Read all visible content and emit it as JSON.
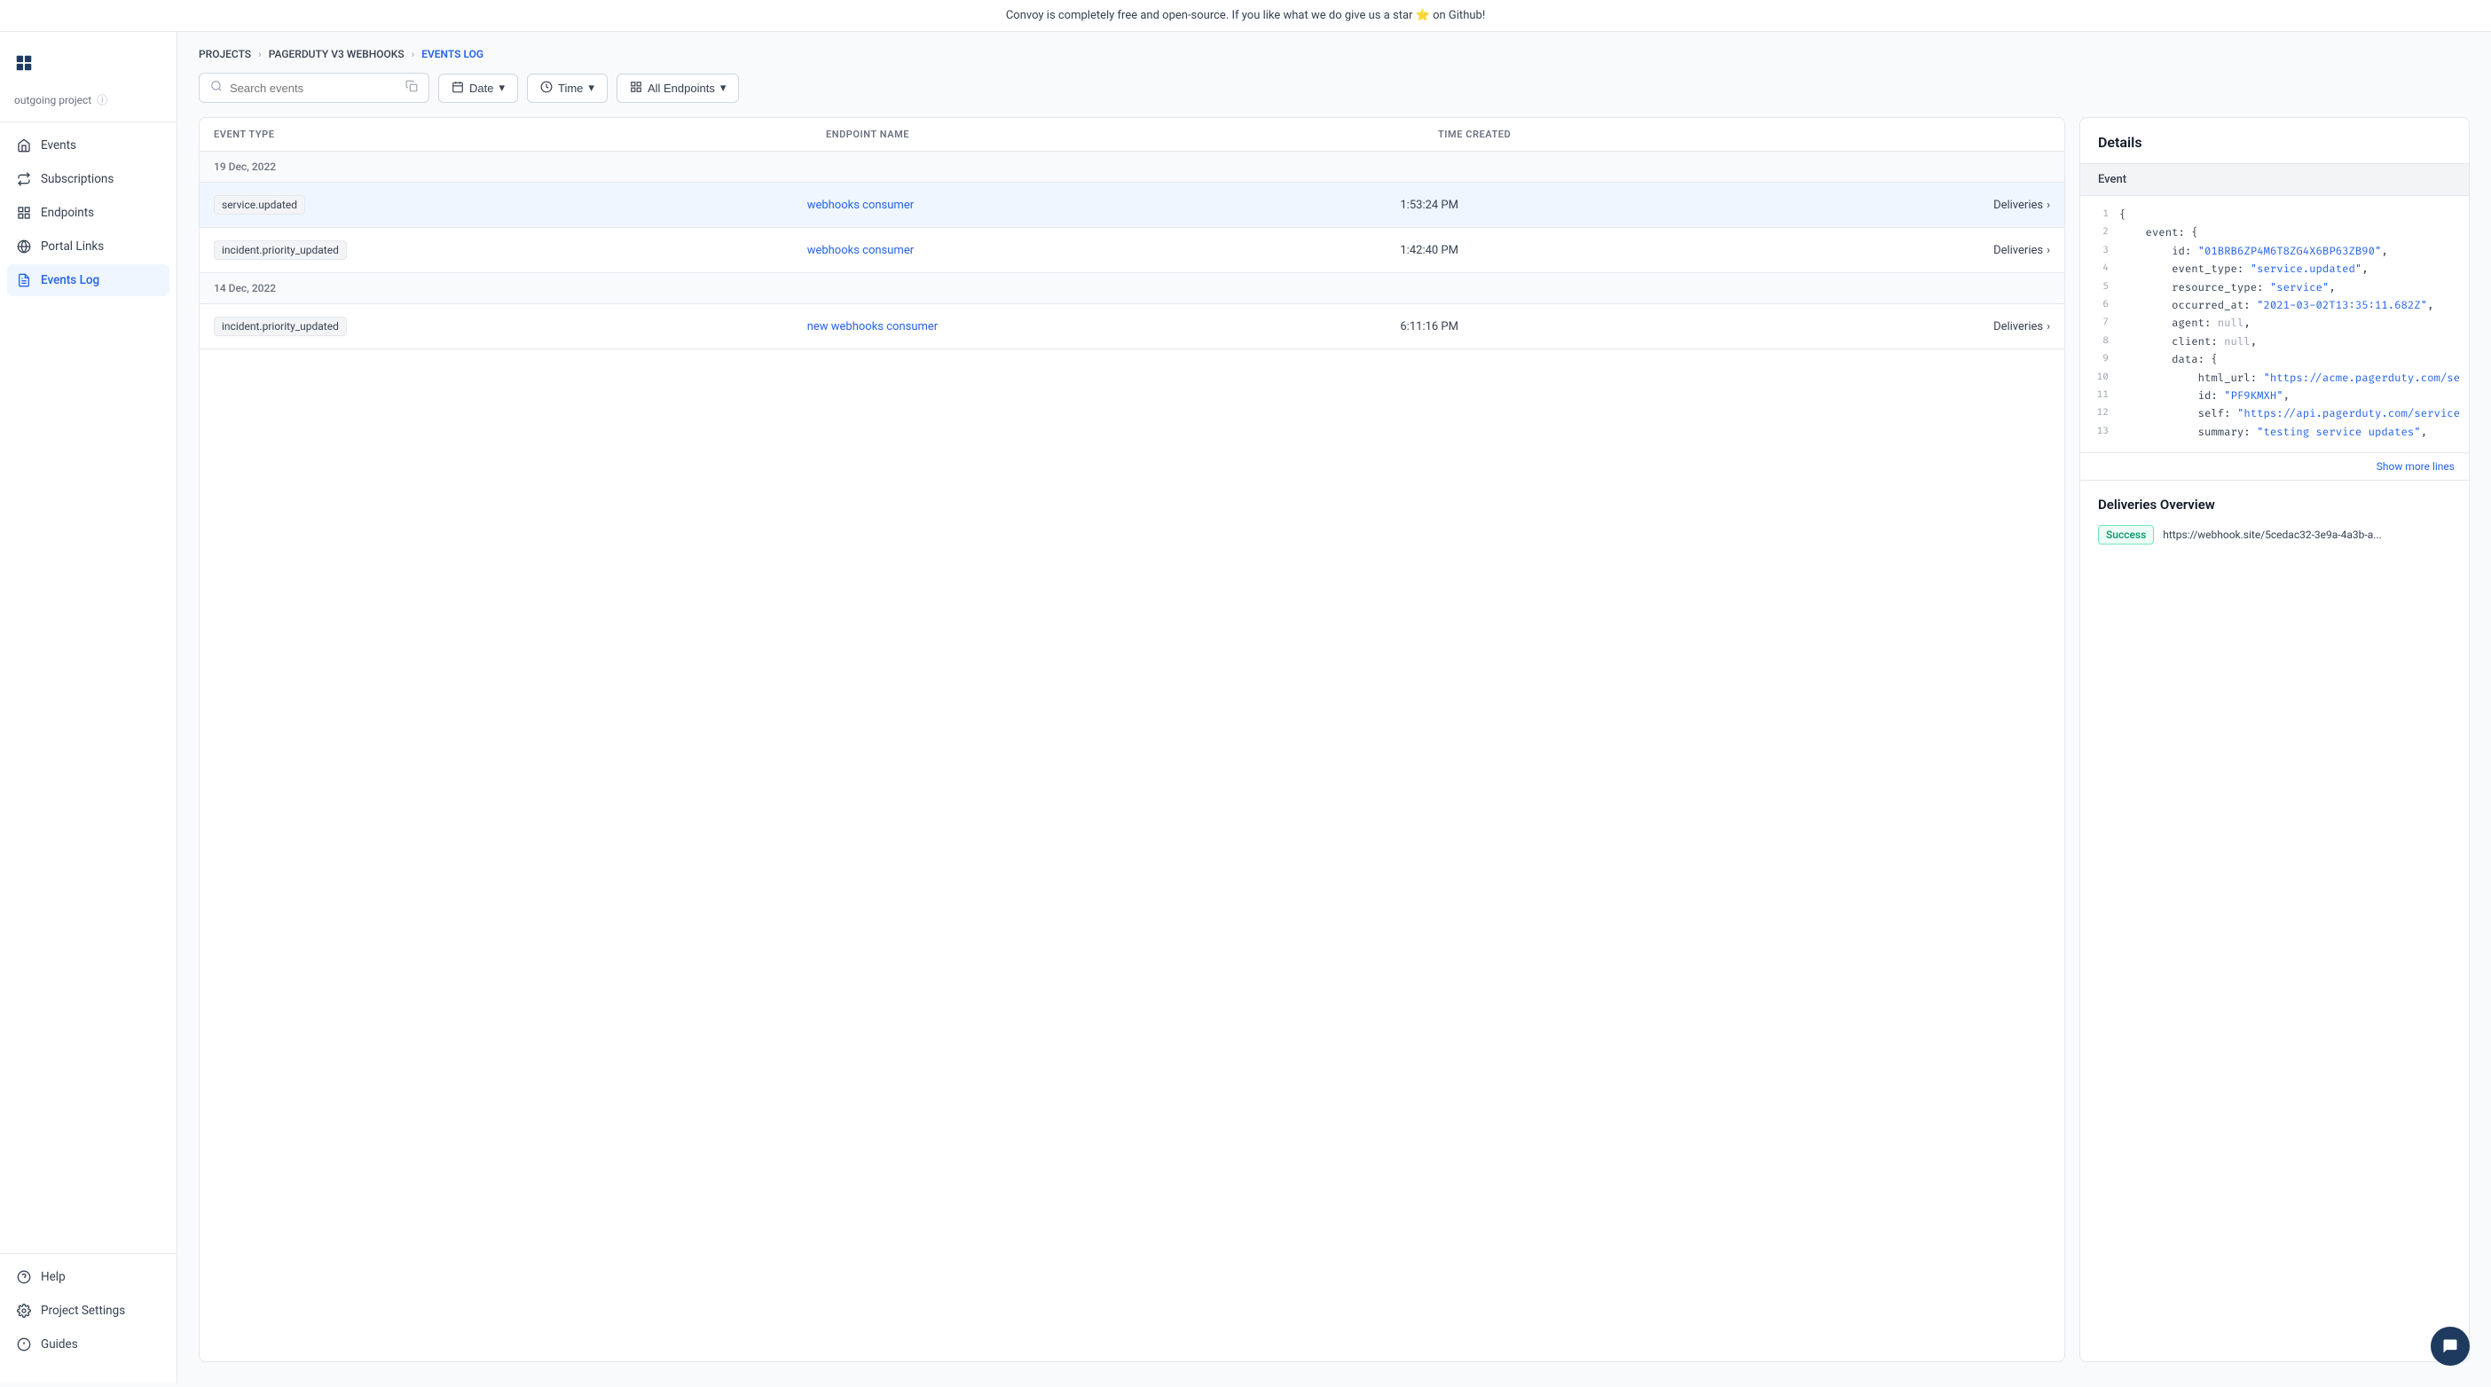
{
  "banner": {
    "text": "Convoy is completely free and open-source. If you like what we do give us a star ⭐ on Github!"
  },
  "sidebar": {
    "project_label": "outgoing project",
    "nav_items": [
      {
        "id": "events",
        "label": "Events",
        "icon": "home"
      },
      {
        "id": "subscriptions",
        "label": "Subscriptions",
        "icon": "subscriptions"
      },
      {
        "id": "endpoints",
        "label": "Endpoints",
        "icon": "endpoints"
      },
      {
        "id": "portal-links",
        "label": "Portal Links",
        "icon": "portal"
      },
      {
        "id": "events-log",
        "label": "Events Log",
        "icon": "eventslog",
        "active": true
      }
    ],
    "bottom_items": [
      {
        "id": "help",
        "label": "Help",
        "icon": "help"
      },
      {
        "id": "project-settings",
        "label": "Project Settings",
        "icon": "settings"
      },
      {
        "id": "guides",
        "label": "Guides",
        "icon": "guides"
      }
    ]
  },
  "breadcrumb": {
    "items": [
      {
        "label": "PROJECTS",
        "type": "link"
      },
      {
        "label": "PAGERDUTY V3 WEBHOOKS",
        "type": "link"
      },
      {
        "label": "EVENTS LOG",
        "type": "current"
      }
    ]
  },
  "toolbar": {
    "search_placeholder": "Search events",
    "date_label": "Date",
    "time_label": "Time",
    "endpoints_label": "All Endpoints"
  },
  "table": {
    "headers": [
      "EVENT TYPE",
      "ENDPOINT NAME",
      "TIME CREATED",
      ""
    ],
    "date_groups": [
      {
        "date": "19 Dec, 2022",
        "rows": [
          {
            "event_type": "service.updated",
            "endpoint_name": "webhooks consumer",
            "time_created": "1:53:24 PM",
            "action": "Deliveries",
            "selected": true
          },
          {
            "event_type": "incident.priority_updated",
            "endpoint_name": "webhooks consumer",
            "time_created": "1:42:40 PM",
            "action": "Deliveries",
            "selected": false
          }
        ]
      },
      {
        "date": "14 Dec, 2022",
        "rows": [
          {
            "event_type": "incident.priority_updated",
            "endpoint_name": "new webhooks consumer",
            "time_created": "6:11:16 PM",
            "action": "Deliveries",
            "selected": false
          }
        ]
      }
    ]
  },
  "details": {
    "title": "Details",
    "tab_label": "Event",
    "code_lines": [
      {
        "num": 1,
        "content": "{"
      },
      {
        "num": 2,
        "content": "    event: {"
      },
      {
        "num": 3,
        "content": "        id: \"01BRB6ZP4M6T8ZG4X6BP63ZB90\","
      },
      {
        "num": 4,
        "content": "        event_type: \"service.updated\","
      },
      {
        "num": 5,
        "content": "        resource_type: \"service\","
      },
      {
        "num": 6,
        "content": "        occurred_at: \"2021-03-02T13:35:11.682Z\","
      },
      {
        "num": 7,
        "content": "        agent: null,"
      },
      {
        "num": 8,
        "content": "        client: null,"
      },
      {
        "num": 9,
        "content": "        data: {"
      },
      {
        "num": 10,
        "content": "            html_url: \"https://acme.pagerduty.com/se"
      },
      {
        "num": 11,
        "content": "            id: \"PF9KMXH\","
      },
      {
        "num": 12,
        "content": "            self: \"https://api.pagerduty.com/service"
      },
      {
        "num": 13,
        "content": "            summary: \"testing service updates\","
      }
    ],
    "show_more_label": "Show more lines",
    "deliveries_overview": {
      "title": "Deliveries Overview",
      "items": [
        {
          "status": "Success",
          "url": "https://webhook.site/5cedac32-3e9a-4a3b-a..."
        }
      ]
    }
  },
  "chat_icon": "💬"
}
